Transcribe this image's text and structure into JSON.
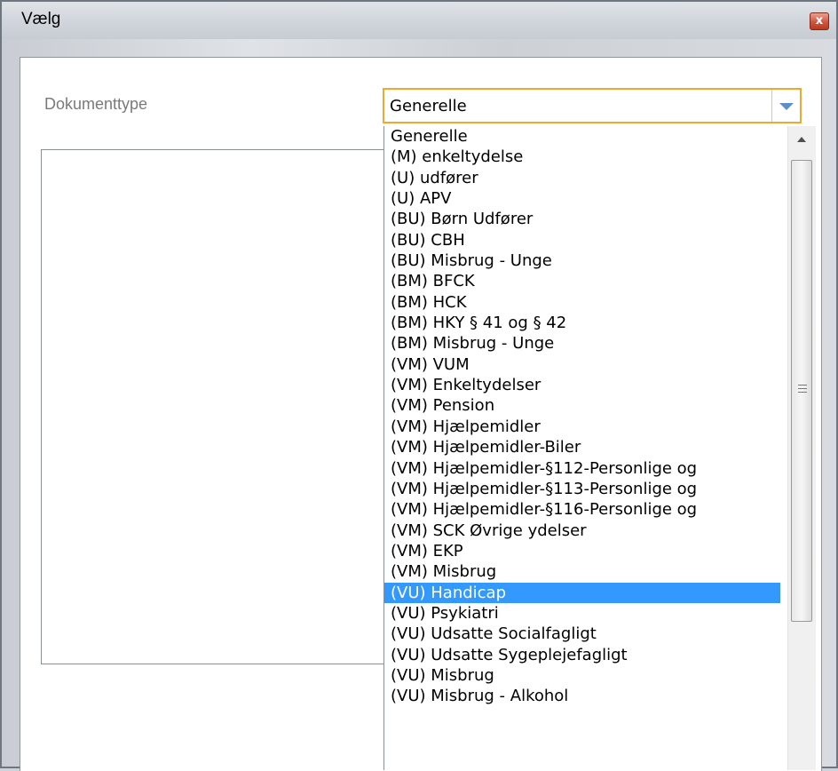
{
  "window": {
    "title": "Vælg",
    "close_glyph": "x"
  },
  "form": {
    "label": "Dokumenttype",
    "selected_value": "Generelle"
  },
  "dropdown": {
    "highlighted_index": 23,
    "items": [
      "Generelle",
      "(M) enkeltydelse",
      "(U) udfører",
      "(U) APV",
      "(BU) Børn Udfører",
      "(BU) CBH",
      "(BU) Misbrug - Unge",
      "(BM) BFCK",
      "(BM) HCK",
      "(BM) HKY § 41 og § 42",
      "(BM) Misbrug - Unge",
      "(VM) VUM",
      "(VM) Enkeltydelser",
      "(VM) Pension",
      "(VM) Hjælpemidler",
      "(VM) Hjælpemidler-Biler",
      "(VM) Hjælpemidler-§112-Personlige og",
      "(VM) Hjælpemidler-§113-Personlige og",
      "(VM) Hjælpemidler-§116-Personlige og",
      "(VM) SCK Øvrige ydelser",
      "(VM) EKP",
      "(VM) Misbrug",
      "(VU) Handicap",
      "(VU) Psykiatri",
      "(VU) Udsatte Socialfagligt",
      "(VU) Udsatte Sygeplejefagligt",
      "(VU) Misbrug",
      "(VU) Misbrug - Alkohol"
    ]
  },
  "colors": {
    "focus_border": "#f0a830",
    "highlight": "#3399ff",
    "arrow": "#5b8fc7"
  }
}
